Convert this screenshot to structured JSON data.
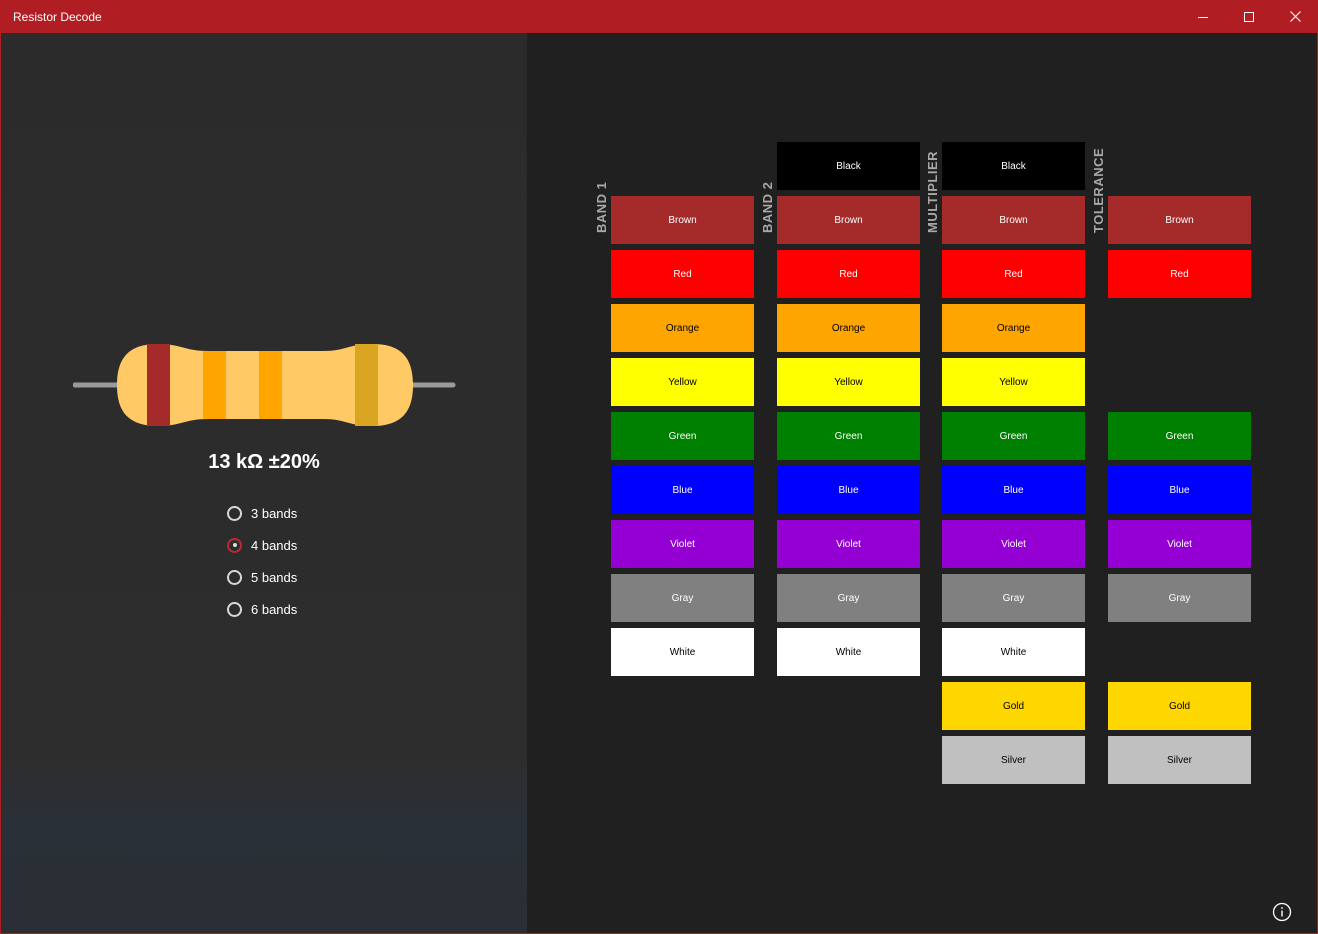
{
  "window": {
    "title": "Resistor Decode"
  },
  "resistor": {
    "value_text": "13 kΩ ±20%",
    "body_color": "#ffc966",
    "band_colors": [
      "#a52a2a",
      "#ffa500",
      "#ffa500",
      "#daa520"
    ]
  },
  "band_modes": [
    {
      "label": "3 bands",
      "checked": false
    },
    {
      "label": "4 bands",
      "checked": true
    },
    {
      "label": "5 bands",
      "checked": false
    },
    {
      "label": "6 bands",
      "checked": false
    }
  ],
  "columns": [
    {
      "label": "BAND 1",
      "items": [
        {
          "slot": 1,
          "name": "Brown",
          "color": "#a52a2a",
          "text": "#ffffff"
        },
        {
          "slot": 2,
          "name": "Red",
          "color": "#ff0000",
          "text": "#ffffff"
        },
        {
          "slot": 3,
          "name": "Orange",
          "color": "#ffa500",
          "text": "#000000"
        },
        {
          "slot": 4,
          "name": "Yellow",
          "color": "#ffff00",
          "text": "#000000"
        },
        {
          "slot": 5,
          "name": "Green",
          "color": "#008000",
          "text": "#ffffff"
        },
        {
          "slot": 6,
          "name": "Blue",
          "color": "#0000ff",
          "text": "#ffffff"
        },
        {
          "slot": 7,
          "name": "Violet",
          "color": "#9400d3",
          "text": "#ffffff"
        },
        {
          "slot": 8,
          "name": "Gray",
          "color": "#808080",
          "text": "#ffffff"
        },
        {
          "slot": 9,
          "name": "White",
          "color": "#ffffff",
          "text": "#000000"
        }
      ]
    },
    {
      "label": "BAND 2",
      "items": [
        {
          "slot": 0,
          "name": "Black",
          "color": "#000000",
          "text": "#ffffff"
        },
        {
          "slot": 1,
          "name": "Brown",
          "color": "#a52a2a",
          "text": "#ffffff"
        },
        {
          "slot": 2,
          "name": "Red",
          "color": "#ff0000",
          "text": "#ffffff"
        },
        {
          "slot": 3,
          "name": "Orange",
          "color": "#ffa500",
          "text": "#000000"
        },
        {
          "slot": 4,
          "name": "Yellow",
          "color": "#ffff00",
          "text": "#000000"
        },
        {
          "slot": 5,
          "name": "Green",
          "color": "#008000",
          "text": "#ffffff"
        },
        {
          "slot": 6,
          "name": "Blue",
          "color": "#0000ff",
          "text": "#ffffff"
        },
        {
          "slot": 7,
          "name": "Violet",
          "color": "#9400d3",
          "text": "#ffffff"
        },
        {
          "slot": 8,
          "name": "Gray",
          "color": "#808080",
          "text": "#ffffff"
        },
        {
          "slot": 9,
          "name": "White",
          "color": "#ffffff",
          "text": "#000000"
        }
      ]
    },
    {
      "label": "MULTIPLIER",
      "items": [
        {
          "slot": 0,
          "name": "Black",
          "color": "#000000",
          "text": "#ffffff"
        },
        {
          "slot": 1,
          "name": "Brown",
          "color": "#a52a2a",
          "text": "#ffffff"
        },
        {
          "slot": 2,
          "name": "Red",
          "color": "#ff0000",
          "text": "#ffffff"
        },
        {
          "slot": 3,
          "name": "Orange",
          "color": "#ffa500",
          "text": "#000000"
        },
        {
          "slot": 4,
          "name": "Yellow",
          "color": "#ffff00",
          "text": "#000000"
        },
        {
          "slot": 5,
          "name": "Green",
          "color": "#008000",
          "text": "#ffffff"
        },
        {
          "slot": 6,
          "name": "Blue",
          "color": "#0000ff",
          "text": "#ffffff"
        },
        {
          "slot": 7,
          "name": "Violet",
          "color": "#9400d3",
          "text": "#ffffff"
        },
        {
          "slot": 8,
          "name": "Gray",
          "color": "#808080",
          "text": "#ffffff"
        },
        {
          "slot": 9,
          "name": "White",
          "color": "#ffffff",
          "text": "#000000"
        },
        {
          "slot": 10,
          "name": "Gold",
          "color": "#ffd700",
          "text": "#000000"
        },
        {
          "slot": 11,
          "name": "Silver",
          "color": "#c0c0c0",
          "text": "#000000"
        }
      ]
    },
    {
      "label": "TOLERANCE",
      "items": [
        {
          "slot": 1,
          "name": "Brown",
          "color": "#a52a2a",
          "text": "#ffffff"
        },
        {
          "slot": 2,
          "name": "Red",
          "color": "#ff0000",
          "text": "#ffffff"
        },
        {
          "slot": 5,
          "name": "Green",
          "color": "#008000",
          "text": "#ffffff"
        },
        {
          "slot": 6,
          "name": "Blue",
          "color": "#0000ff",
          "text": "#ffffff"
        },
        {
          "slot": 7,
          "name": "Violet",
          "color": "#9400d3",
          "text": "#ffffff"
        },
        {
          "slot": 8,
          "name": "Gray",
          "color": "#808080",
          "text": "#ffffff"
        },
        {
          "slot": 10,
          "name": "Gold",
          "color": "#ffd700",
          "text": "#000000"
        },
        {
          "slot": 11,
          "name": "Silver",
          "color": "#c0c0c0",
          "text": "#000000"
        }
      ]
    }
  ]
}
